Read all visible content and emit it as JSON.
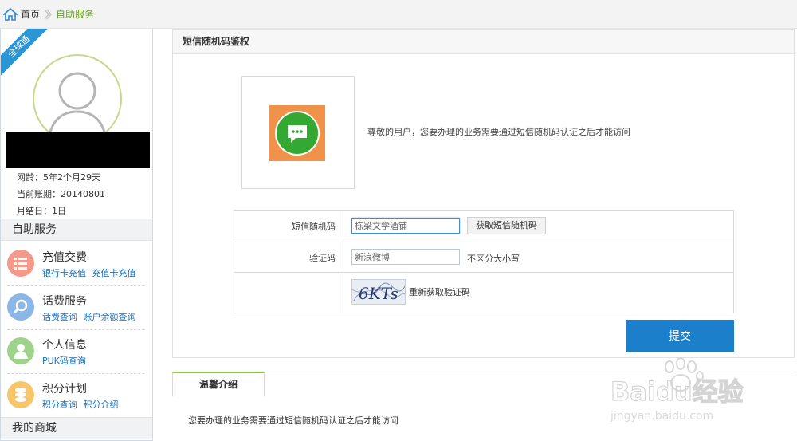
{
  "breadcrumb": {
    "home": "首页",
    "current": "自助服务"
  },
  "sidebar": {
    "badge": "全球通",
    "net_age": "网龄：5年2个月29天",
    "bill_period": "当前账期：20140801",
    "bill_day": "月结日：1日",
    "section_self_service": "自助服务",
    "items": [
      {
        "title": "充值交费",
        "links": [
          "银行卡充值",
          "充值卡充值"
        ],
        "icon": "list-icon",
        "color": "#f49a8c"
      },
      {
        "title": "话费服务",
        "links": [
          "话费查询",
          "账户余额查询"
        ],
        "icon": "search-icon",
        "color": "#8ab6e8"
      },
      {
        "title": "个人信息",
        "links": [
          "PUK码查询"
        ],
        "icon": "person-icon",
        "color": "#9dd38a"
      },
      {
        "title": "积分计划",
        "links": [
          "积分查询",
          "积分介绍"
        ],
        "icon": "coins-icon",
        "color": "#f7c66b"
      }
    ],
    "section_mall": "我的商城"
  },
  "main": {
    "title": "短信随机码鉴权",
    "notice": "尊敬的用户，您要办理的业务需要通过短信随机码认证之后才能访问",
    "sms_label": "短信随机码",
    "sms_value": "栋梁文学酒铺",
    "get_code_button": "获取短信随机码",
    "captcha_label": "验证码",
    "captcha_value": "新浪微博",
    "captcha_hint": "不区分大小写",
    "captcha_image_text": "6KTs",
    "refresh_captcha": "重新获取验证码",
    "submit": "提交"
  },
  "tips": {
    "tab": "温馨介绍",
    "text": "您要办理的业务需要通过短信随机码认证之后才能访问"
  },
  "watermark": {
    "brand": "Baidu经验",
    "url": "jingyan.baidu.com"
  }
}
